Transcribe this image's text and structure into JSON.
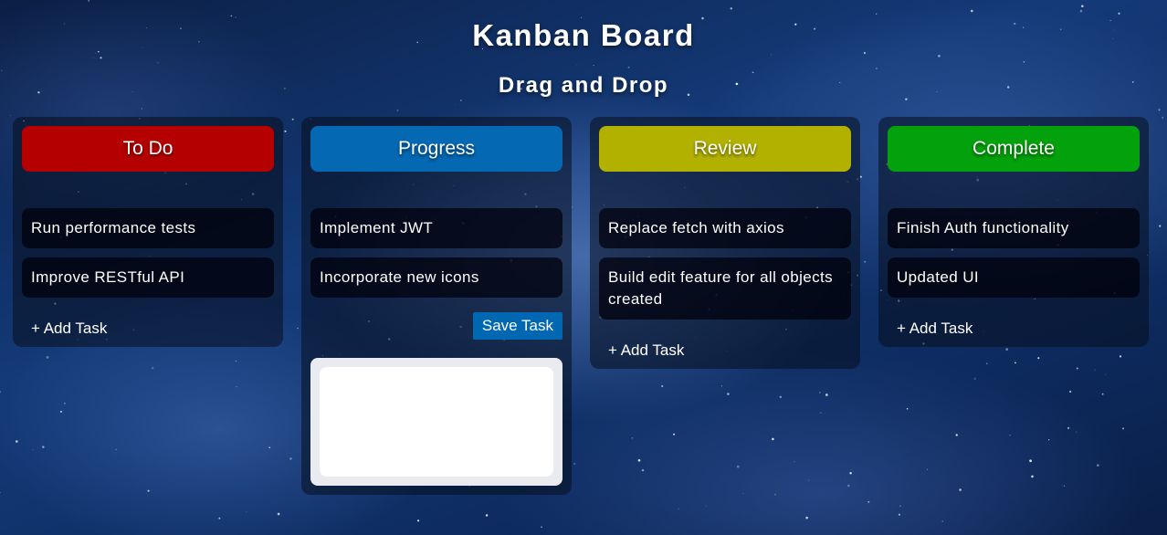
{
  "header": {
    "title": "Kanban Board",
    "subtitle": "Drag and Drop"
  },
  "columns": [
    {
      "name": "To Do",
      "color": "#b50000",
      "tasks": [
        "Run performance tests",
        "Improve RESTful API"
      ],
      "add_label": "+ Add Task"
    },
    {
      "name": "Progress",
      "color": "#0468b3",
      "tasks": [
        "Implement JWT",
        "Incorporate new icons"
      ],
      "save_label": "Save Task",
      "input_value": ""
    },
    {
      "name": "Review",
      "color": "#b3b100",
      "tasks": [
        "Replace fetch with axios",
        "Build edit feature for all objects created"
      ],
      "add_label": "+ Add Task"
    },
    {
      "name": "Complete",
      "color": "#03a10b",
      "tasks": [
        "Finish Auth functionality",
        "Updated UI"
      ],
      "add_label": "+ Add Task"
    }
  ]
}
